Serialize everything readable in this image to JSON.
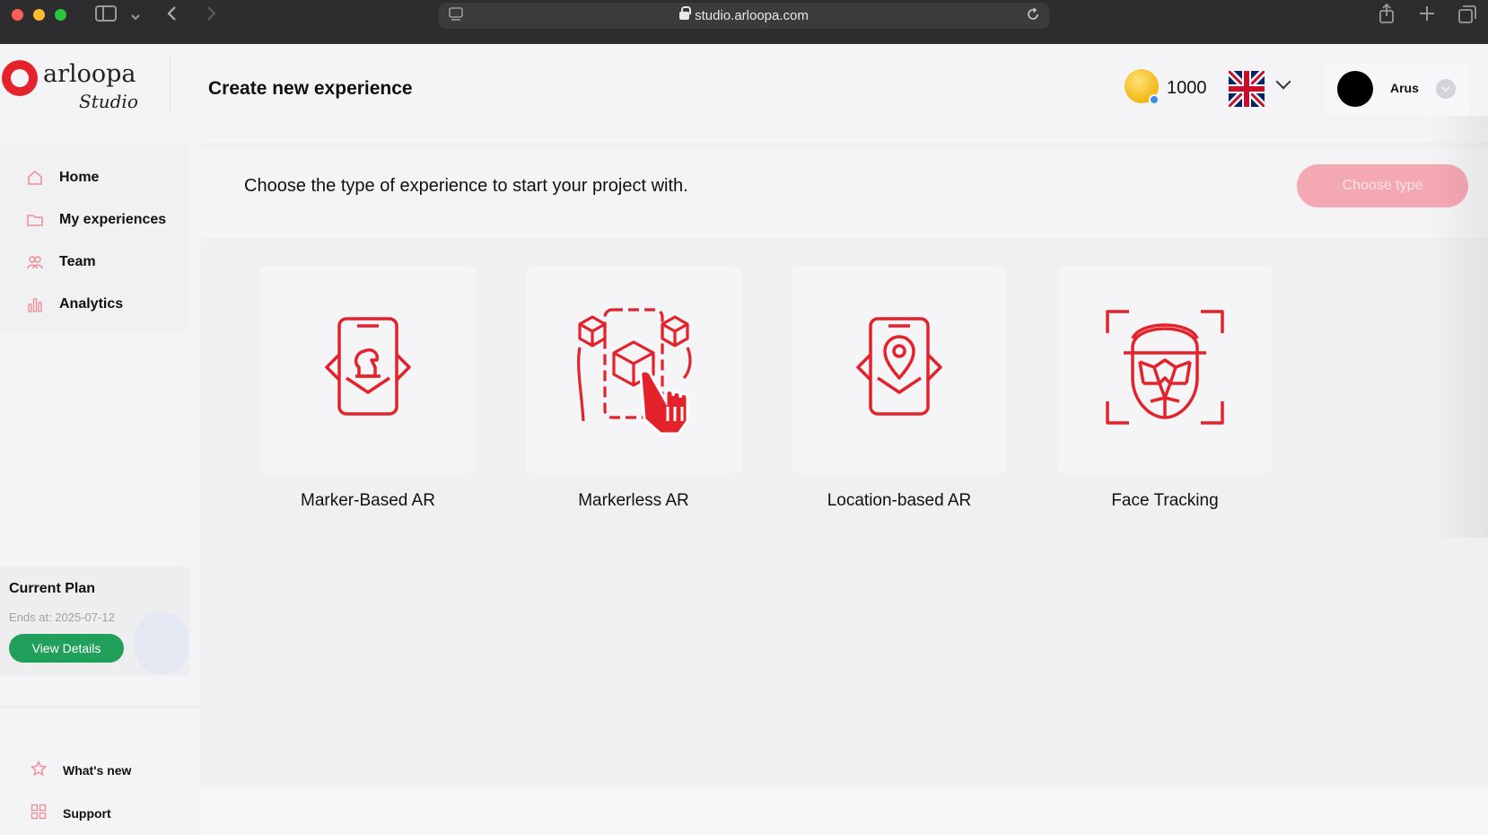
{
  "browser": {
    "url": "studio.arloopa.com"
  },
  "header": {
    "logo_word": "arloopa",
    "logo_sub": "Studio",
    "page_title": "Create new experience",
    "coins": "1000",
    "user_name": "Arus"
  },
  "sidebar": {
    "items": [
      {
        "label": "Home",
        "icon": "home-icon"
      },
      {
        "label": "My experiences",
        "icon": "folder-icon"
      },
      {
        "label": "Team",
        "icon": "team-icon"
      },
      {
        "label": "Analytics",
        "icon": "analytics-icon"
      }
    ],
    "plan": {
      "title": "Current Plan",
      "ends": "Ends at: 2025-07-12",
      "button": "View Details"
    },
    "bottom": [
      {
        "label": "What's new",
        "icon": "star-icon"
      },
      {
        "label": "Support",
        "icon": "support-icon"
      }
    ]
  },
  "main": {
    "prompt": "Choose the type of experience to start your project with.",
    "choose_button": "Choose type",
    "cards": [
      {
        "label": "Marker-Based AR",
        "icon": "marker-based-ar-icon"
      },
      {
        "label": "Markerless AR",
        "icon": "markerless-ar-icon"
      },
      {
        "label": "Location-based AR",
        "icon": "location-based-ar-icon"
      },
      {
        "label": "Face Tracking",
        "icon": "face-tracking-icon"
      }
    ]
  },
  "colors": {
    "brand_red": "#e3222b",
    "button_green": "#20a05a",
    "disabled_pink": "#f4a8b2"
  }
}
